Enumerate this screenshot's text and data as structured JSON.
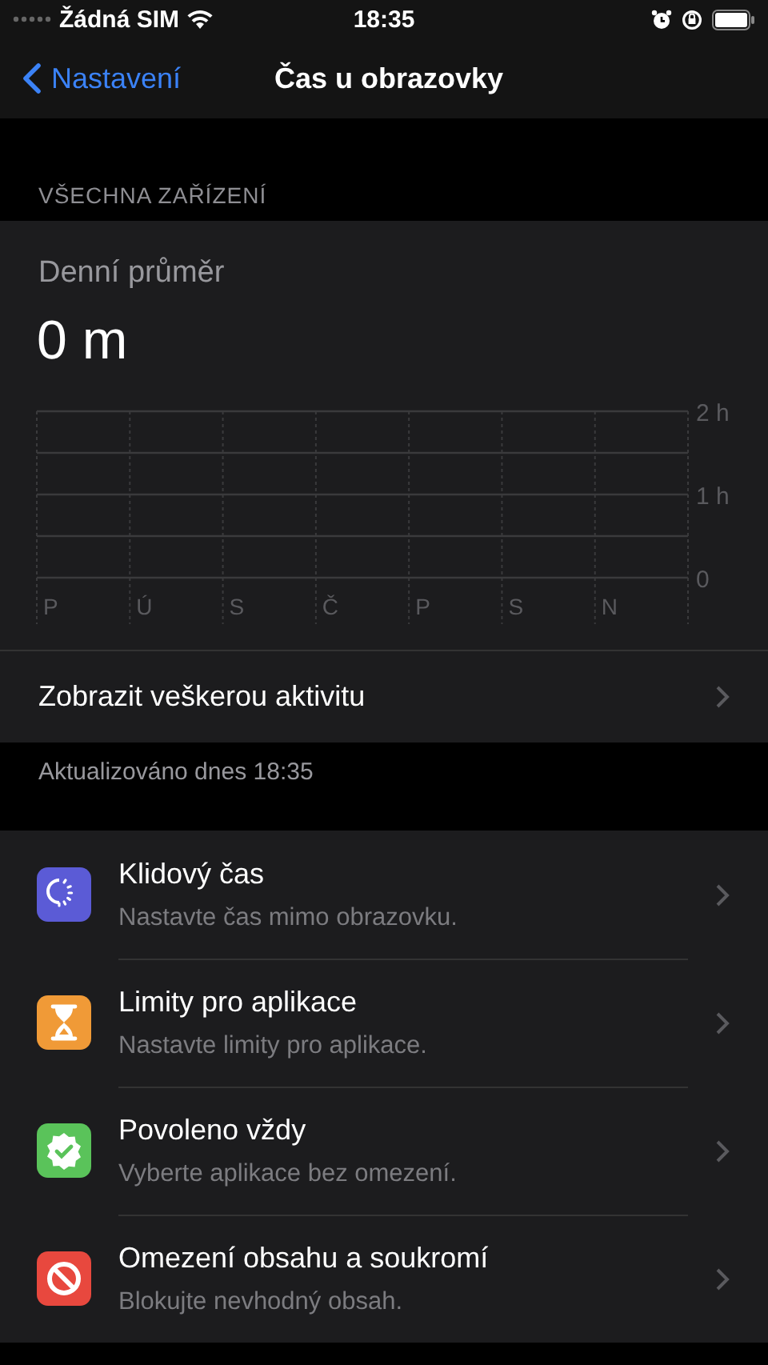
{
  "status_bar": {
    "carrier": "Žádná SIM",
    "time": "18:35"
  },
  "nav": {
    "back": "Nastavení",
    "title": "Čas u obrazovky"
  },
  "section_header": "VŠECHNA ZAŘÍZENÍ",
  "summary": {
    "label": "Denní průměr",
    "value": "0 m",
    "chart_data": {
      "type": "bar",
      "categories": [
        "P",
        "Ú",
        "S",
        "Č",
        "P",
        "S",
        "N"
      ],
      "values": [
        0,
        0,
        0,
        0,
        0,
        0,
        0
      ],
      "ylim": [
        0,
        2
      ],
      "yticks": [
        {
          "value": 0,
          "label": "0"
        },
        {
          "value": 1,
          "label": "1 h"
        },
        {
          "value": 2,
          "label": "2 h"
        }
      ]
    },
    "link": "Zobrazit veškerou aktivitu"
  },
  "updated": "Aktualizováno dnes 18:35",
  "items": [
    {
      "kind": "downtime",
      "color": "#5b5bd6",
      "title": "Klidový čas",
      "subtitle": "Nastavte čas mimo obrazovku."
    },
    {
      "kind": "limits",
      "color": "#f09a37",
      "title": "Limity pro aplikace",
      "subtitle": "Nastavte limity pro aplikace."
    },
    {
      "kind": "always",
      "color": "#5ac35a",
      "title": "Povoleno vždy",
      "subtitle": "Vyberte aplikace bez omezení."
    },
    {
      "kind": "content",
      "color": "#e8483e",
      "title": "Omezení obsahu a soukromí",
      "subtitle": "Blokujte nevhodný obsah."
    }
  ]
}
